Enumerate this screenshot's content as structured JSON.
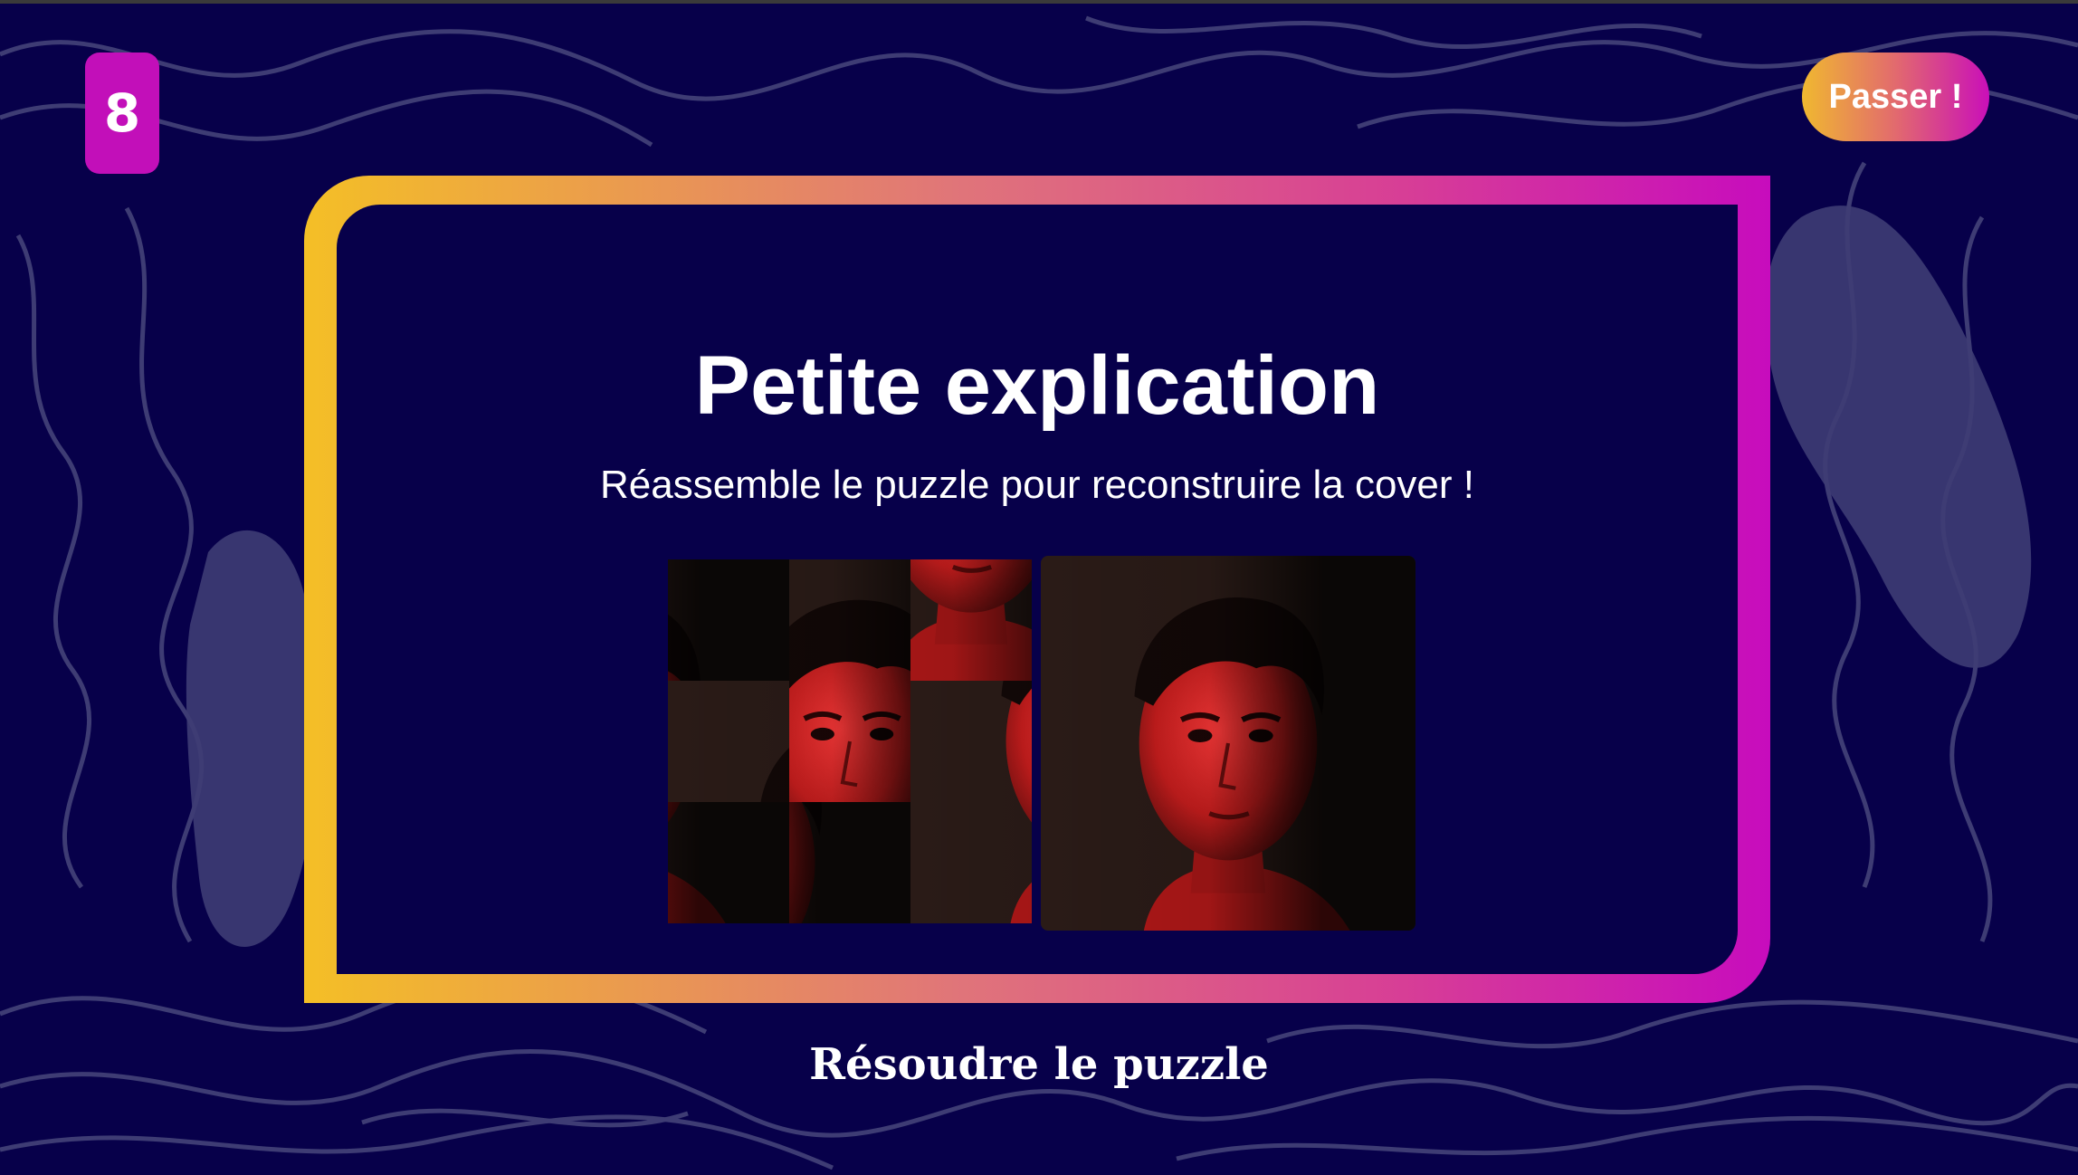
{
  "header": {
    "round_number": "8",
    "skip_label": "Passer !"
  },
  "explanation": {
    "title": "Petite explication",
    "instruction": "Réassemble le puzzle pour reconstruire la cover !"
  },
  "puzzle": {
    "grid_size": 3,
    "tile_order": [
      2,
      1,
      7,
      0,
      4,
      3,
      8,
      5,
      6
    ]
  },
  "footer": {
    "action_label": "Résoudre le puzzle"
  },
  "colors": {
    "background": "#07004a",
    "accent_magenta": "#c90fb9",
    "accent_yellow": "#f4bf26",
    "line": "#3e3c74"
  }
}
